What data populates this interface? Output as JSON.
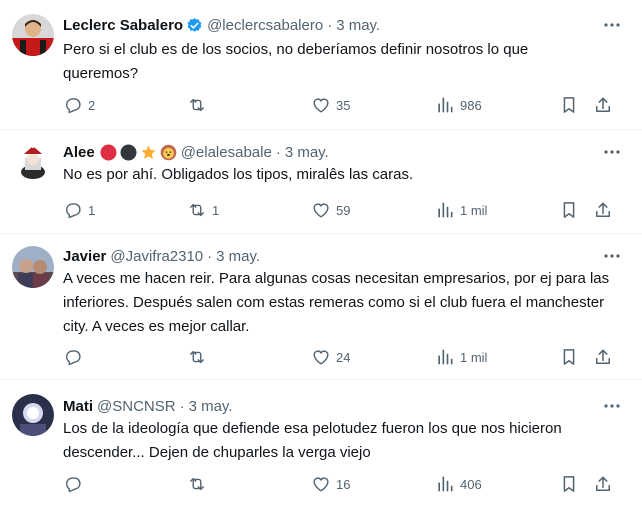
{
  "tweets": [
    {
      "name": "Leclerc Sabalero",
      "verified": true,
      "handle": "@leclercsabalero",
      "date": "3 may.",
      "text": "Pero si el club es de los socios, no deberíamos definir nosotros lo que queremos?",
      "replies": "2",
      "retweets": "",
      "likes": "35",
      "views": "986"
    },
    {
      "name": "Alee",
      "emojis": [
        "red-circle",
        "black-circle",
        "star",
        "lion-face"
      ],
      "handle": "@elalesabale",
      "date": "3 may.",
      "text": "No es por ahí. Obligados los tipos, miralês las caras.",
      "replies": "1",
      "retweets": "1",
      "likes": "59",
      "views": "1 mil"
    },
    {
      "name": "Javier",
      "handle": "@Javifra2310",
      "date": "3 may.",
      "text": "A veces me hacen reir. Para algunas cosas necesitan empresarios, por ej para las inferiores. Después salen com estas remeras como si el club fuera el manchester city. A veces es mejor callar.",
      "replies": "",
      "retweets": "",
      "likes": "24",
      "views": "1 mil"
    },
    {
      "name": "Mati",
      "handle": "@SNCNSR",
      "date": "3 may.",
      "text": "Los de la ideología que defiende esa pelotudez fueron los que nos hicieron descender... Dejen de chuparles la verga viejo",
      "replies": "",
      "retweets": "",
      "likes": "16",
      "views": "406"
    }
  ],
  "separator": "·",
  "colors": {
    "text": "#0f1419",
    "secondary": "#536471",
    "verified": "#1d9bf0",
    "border": "#eff3f4"
  }
}
